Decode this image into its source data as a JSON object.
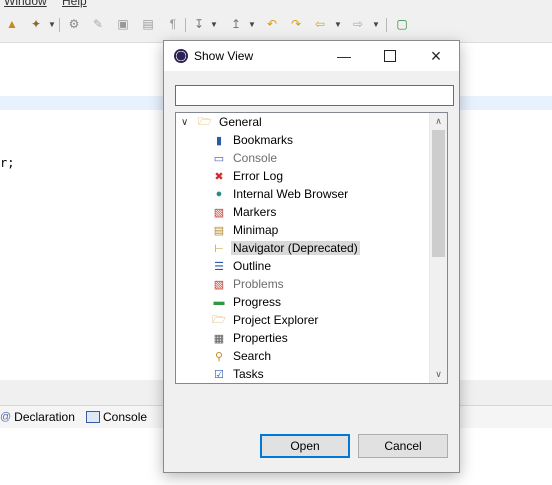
{
  "menu": {
    "window": "Window",
    "help": "Help"
  },
  "editor": {
    "code_fragment": "r;"
  },
  "bottom_tabs": [
    {
      "label": "Declaration",
      "icon": "declaration-icon"
    },
    {
      "label": "Console",
      "icon": "console-icon"
    }
  ],
  "dialog": {
    "title": "Show View",
    "filter": {
      "value": "",
      "placeholder": ""
    },
    "tree": {
      "root": {
        "label": "General",
        "icon": "folder-open-icon",
        "expanded": true
      },
      "items": [
        {
          "label": "Bookmarks",
          "icon": "bookmarks-icon"
        },
        {
          "label": "Console",
          "icon": "console-icon",
          "dimmed": true
        },
        {
          "label": "Error Log",
          "icon": "error-log-icon"
        },
        {
          "label": "Internal Web Browser",
          "icon": "globe-icon"
        },
        {
          "label": "Markers",
          "icon": "markers-icon"
        },
        {
          "label": "Minimap",
          "icon": "minimap-icon"
        },
        {
          "label": "Navigator (Deprecated)",
          "icon": "navigator-icon",
          "selected": true
        },
        {
          "label": "Outline",
          "icon": "outline-icon"
        },
        {
          "label": "Problems",
          "icon": "problems-icon",
          "dimmed": true
        },
        {
          "label": "Progress",
          "icon": "progress-icon"
        },
        {
          "label": "Project Explorer",
          "icon": "project-explorer-icon"
        },
        {
          "label": "Properties",
          "icon": "properties-icon"
        },
        {
          "label": "Search",
          "icon": "search-icon"
        },
        {
          "label": "Tasks",
          "icon": "tasks-icon"
        }
      ]
    },
    "buttons": {
      "open": "Open",
      "cancel": "Cancel"
    }
  },
  "colors": {
    "accent": "#0078d7",
    "selection": "#d9d9d9",
    "editor_highlight": "#e8f2fe"
  }
}
